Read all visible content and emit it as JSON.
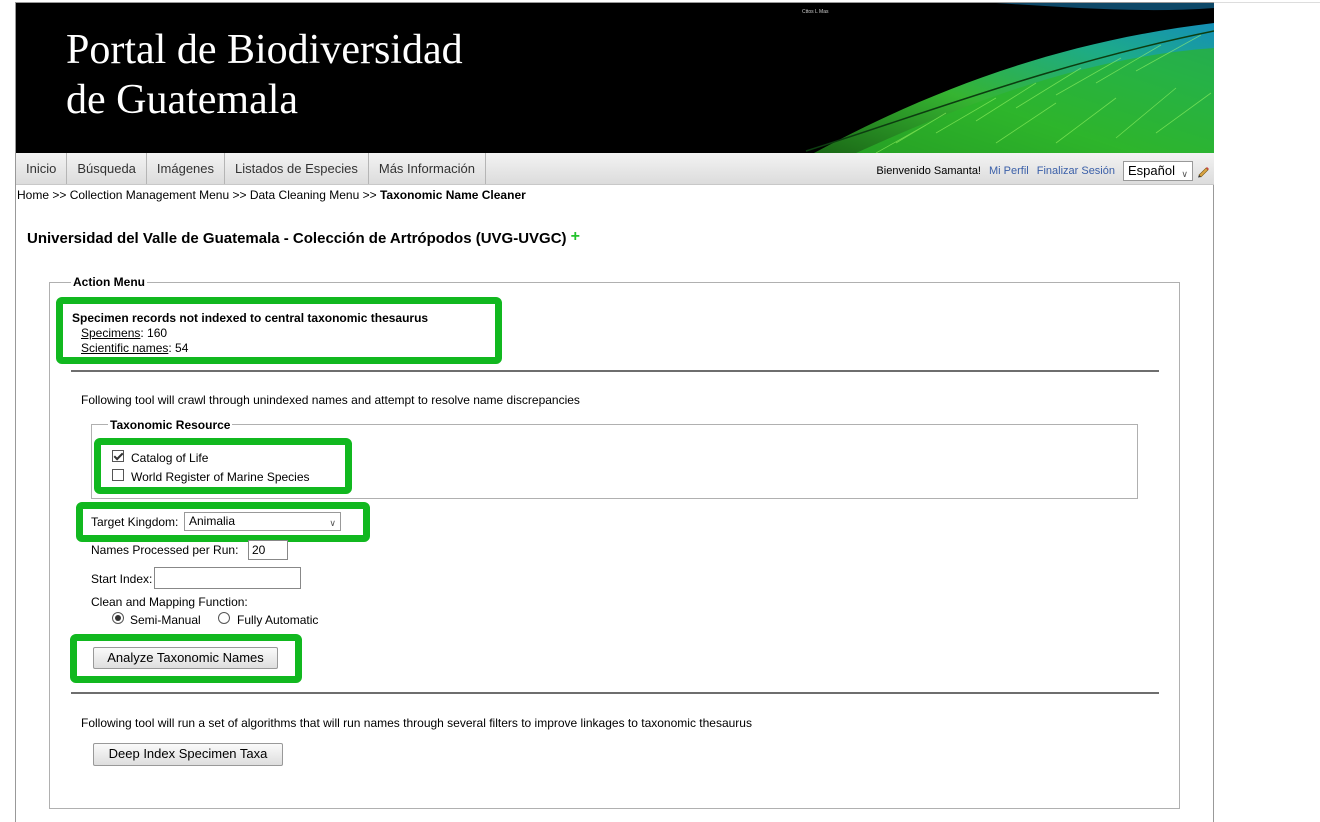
{
  "header": {
    "title_line1": "Portal de Biodiversidad",
    "title_line2": "de Guatemala",
    "image_credit": "Cttos L Mas"
  },
  "nav": {
    "items": [
      {
        "label": "Inicio"
      },
      {
        "label": "Búsqueda"
      },
      {
        "label": "Imágenes"
      },
      {
        "label": "Listados de Especies"
      },
      {
        "label": "Más Información"
      }
    ],
    "welcome": "Bienvenido Samanta!",
    "profile_link": "Mi Perfil",
    "logout_link": "Finalizar Sesión",
    "language": "Español"
  },
  "breadcrumb": {
    "home": "Home",
    "sep": ">>",
    "collection_menu": "Collection Management Menu",
    "cleaning_menu": "Data Cleaning Menu",
    "current": "Taxonomic Name Cleaner"
  },
  "collection": {
    "title": "Universidad del Valle de Guatemala - Colección de Artrópodos (UVG-UVGC)",
    "plus_symbol": "+"
  },
  "action_menu": {
    "legend": "Action Menu",
    "stats_title": "Specimen records not indexed to central taxonomic thesaurus",
    "specimens_label": "Specimens",
    "specimens_value": "160",
    "sci_names_label": "Scientific names",
    "sci_names_value": "54",
    "tool1_desc": "Following tool will crawl through unindexed names and attempt to resolve name discrepancies",
    "taxonomic_resource_legend": "Taxonomic Resource",
    "resources": [
      {
        "label": "Catalog of Life",
        "checked": true
      },
      {
        "label": "World Register of Marine Species",
        "checked": false
      }
    ],
    "target_kingdom_label": "Target Kingdom:",
    "target_kingdom_value": "Animalia",
    "names_per_run_label": "Names Processed per Run:",
    "names_per_run_value": "20",
    "start_index_label": "Start Index:",
    "start_index_value": "",
    "clean_function_label": "Clean and Mapping Function:",
    "clean_options": [
      {
        "label": "Semi-Manual",
        "selected": true
      },
      {
        "label": "Fully Automatic",
        "selected": false
      }
    ],
    "analyze_button": "Analyze Taxonomic Names",
    "tool2_desc": "Following tool will run a set of algorithms that will run names through several filters to improve linkages to taxonomic thesaurus",
    "deep_index_button": "Deep Index Specimen Taxa"
  },
  "colors": {
    "highlight": "#11b81f",
    "banner_bg": "#000000",
    "link": "#3a5fa8",
    "plus": "#22c22c"
  }
}
